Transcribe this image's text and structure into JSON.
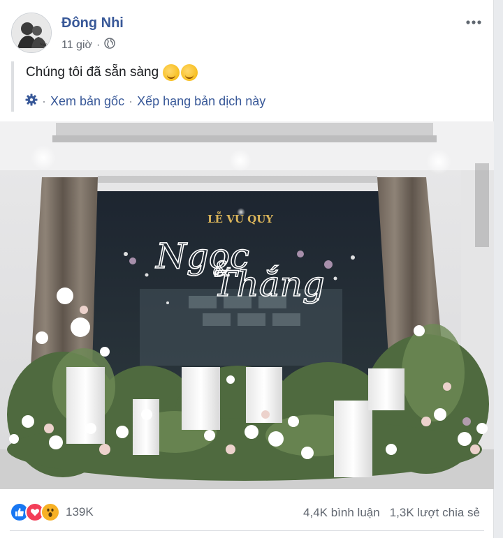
{
  "post": {
    "author": "Đông Nhi",
    "time": "11 giờ",
    "separator": "·",
    "privacy_icon": "globe-icon",
    "text": "Chúng tôi đã sẵn sàng",
    "emojis": [
      "smiling-face-with-hearts",
      "smiling-face-with-hearts"
    ]
  },
  "translation": {
    "settings_icon": "gear-icon",
    "dot": "·",
    "see_original": "Xem bản gốc",
    "rate": "Xếp hạng bản dịch này"
  },
  "photo": {
    "sign_title": "LỄ VU QUY",
    "sign_name1": "Ngọc",
    "sign_amp": "&",
    "sign_name2": "Thắng"
  },
  "footer": {
    "reaction_icons": [
      "like",
      "love",
      "wow"
    ],
    "reaction_count": "139K",
    "comments": "4,4K bình luận",
    "shares": "1,3K lượt chia sẻ"
  },
  "colors": {
    "link": "#385898",
    "meta": "#616770",
    "like": "#1877f2",
    "love": "#f33e58",
    "wow": "#f7b125"
  }
}
